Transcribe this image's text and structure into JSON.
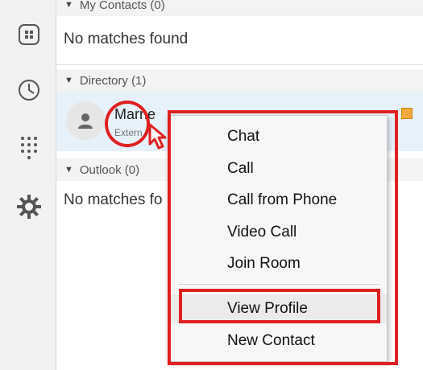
{
  "sections": {
    "my_contacts": {
      "label": "My Contacts (0)",
      "empty_text": "No matches found"
    },
    "directory": {
      "label": "Directory (1)"
    },
    "outlook": {
      "label": "Outlook (0)",
      "empty_text": "No matches fo"
    }
  },
  "contact": {
    "name": "Marne",
    "sub": "Extern"
  },
  "context_menu": {
    "items": [
      {
        "label": "Chat"
      },
      {
        "label": "Call"
      },
      {
        "label": "Call from Phone"
      },
      {
        "label": "Video Call"
      },
      {
        "label": "Join Room"
      },
      {
        "label": "View Profile"
      },
      {
        "label": "New Contact"
      }
    ]
  },
  "sidebar": {
    "icons": [
      "contacts-icon",
      "clock-icon",
      "dialpad-icon",
      "gear-icon"
    ]
  },
  "colors": {
    "highlight_red": "#e02020",
    "selected_row": "#e7f1fa",
    "status_orange": "#f2a93b"
  }
}
